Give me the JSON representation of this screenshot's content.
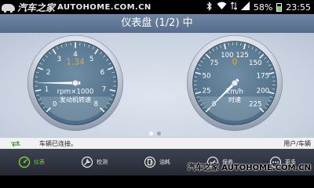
{
  "status_bar": {
    "watermark_cn": "汽车之家",
    "watermark_en": "AUTOHOME.COM.CN",
    "battery_percent": "58%",
    "battery_level": 0.58,
    "time": "23:55",
    "icons": [
      "bluetooth-icon",
      "wifi-icon",
      "mobile-data-icon",
      "signal-icon",
      "battery-icon"
    ]
  },
  "header": {
    "title": "仪表盘 (1/2) 中"
  },
  "gauges": [
    {
      "name": "rpm",
      "readout": "1.34",
      "unit": "rpm×1000",
      "label": "发动机转速",
      "ticks": [
        "0",
        "1",
        "2",
        "3",
        "4",
        "5",
        "6",
        "7",
        "8"
      ],
      "min": 0,
      "max": 8,
      "value": 1.34,
      "readout_color": "#f2a51a"
    },
    {
      "name": "speed",
      "readout": "0",
      "unit": "km/h",
      "label": "时速",
      "ticks": [
        "0",
        "25",
        "50",
        "75",
        "100",
        "125",
        "150",
        "175",
        "200",
        "225"
      ],
      "min": 0,
      "max": 225,
      "value": 0,
      "readout_color": "#f2a51a"
    }
  ],
  "pager": {
    "count": 2,
    "active": 0
  },
  "status_line": {
    "connection_text": "车辆已连接。",
    "user_text": "用户/车辆"
  },
  "nav": {
    "tabs": [
      {
        "label": "仪表",
        "icon": "dashboard-icon",
        "active": true
      },
      {
        "label": "检测",
        "icon": "wrench-icon",
        "active": false
      },
      {
        "label": "油耗",
        "icon": "fuel-icon",
        "active": false
      },
      {
        "label": "保养",
        "icon": "maintenance-icon",
        "active": false
      },
      {
        "label": "更多",
        "icon": "more-icon",
        "active": false
      }
    ]
  },
  "bottom_watermark": "汽车之家  AUTOHOME.COM.CN",
  "colors": {
    "accent_active": "#7ccf37",
    "gauge_face": "#4d6e86",
    "header_bg": "#6580a0"
  }
}
